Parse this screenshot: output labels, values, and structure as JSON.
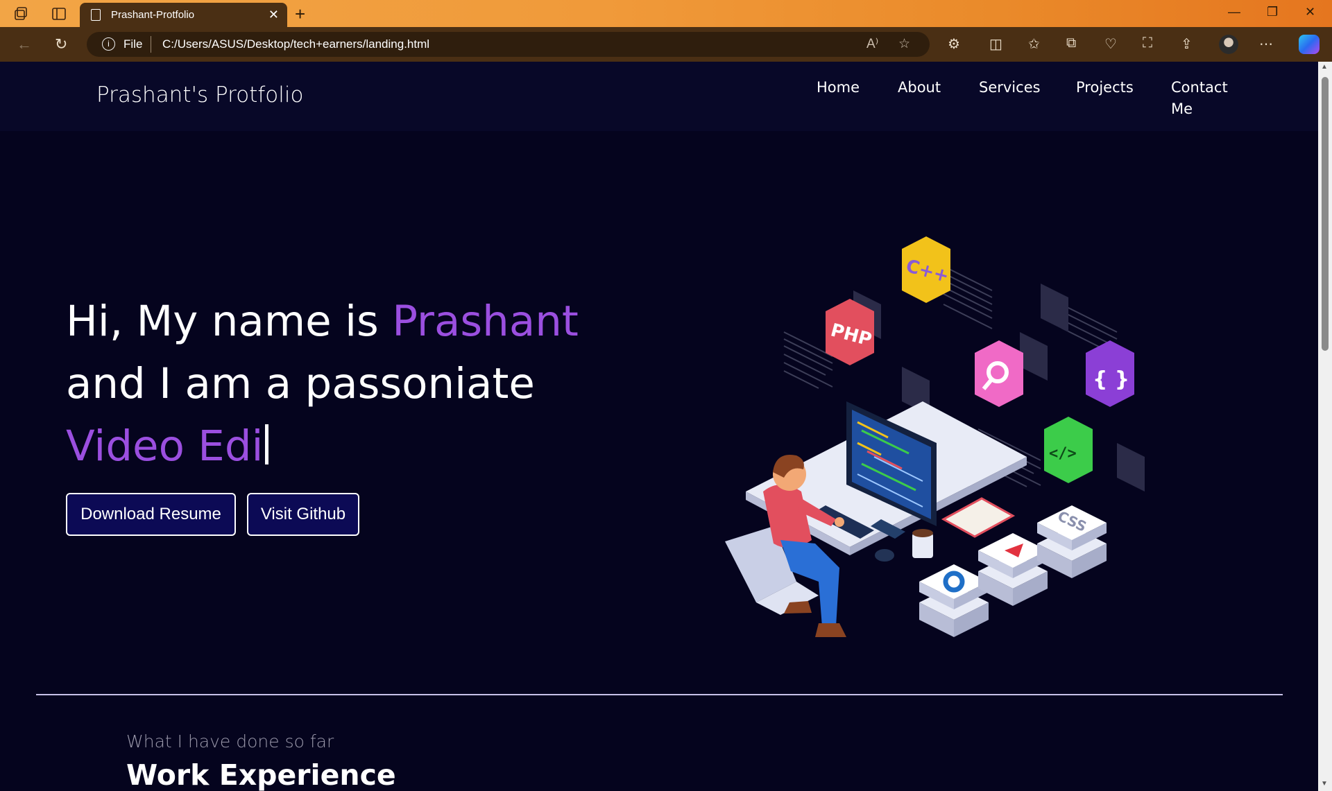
{
  "browser": {
    "tab_title": "Prashant-Protfolio",
    "url_protocol": "File",
    "url": "C:/Users/ASUS/Desktop/tech+earners/landing.html",
    "accent_colors": {
      "tabbar_start": "#f2a546",
      "tabbar_end": "#e5761f",
      "chrome": "#4a2f14"
    }
  },
  "navbar": {
    "brand": "Prashant's Protfolio",
    "links": [
      "Home",
      "About",
      "Services",
      "Projects",
      "Contact",
      "Me"
    ]
  },
  "hero": {
    "line1_prefix": "Hi, My name is ",
    "line1_name": "Prashant",
    "line2": "and I am a passoniate",
    "line3_typed": "Video Edi",
    "buttons": {
      "resume": "Download Resume",
      "github": "Visit Github"
    },
    "accent_color": "#9b4fe0",
    "illustration": {
      "badges": [
        "PHP",
        "C++",
        "{ }",
        "</>",
        "CSS"
      ]
    }
  },
  "experience": {
    "subtitle": "What I have done so far",
    "title": "Work Experience"
  },
  "icons": {
    "workspaces": "workspaces-icon",
    "tab_actions": "tab-actions-icon",
    "back": "back-icon",
    "refresh": "refresh-icon",
    "read_aloud": "read-aloud-icon",
    "favorite": "star-icon",
    "extensions": "extensions-icon",
    "split": "split-screen-icon",
    "favorites": "favorites-icon",
    "collections": "collections-icon",
    "health": "browser-essentials-icon",
    "screenshot": "screenshot-icon",
    "share": "share-icon",
    "more": "more-icon"
  }
}
